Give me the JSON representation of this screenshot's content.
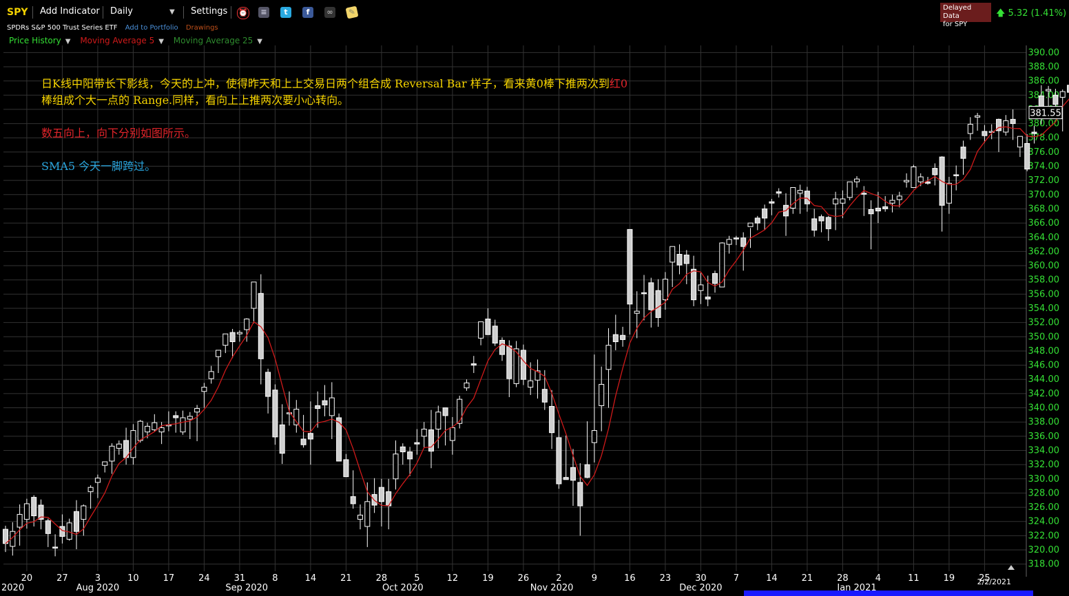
{
  "toolbar": {
    "ticker": "SPY",
    "add_indicator": "Add Indicator",
    "period": "Daily",
    "settings": "Settings",
    "delayed_line1": "Delayed Data",
    "delayed_line2": "for SPY",
    "change": "5.32 (1.41%)"
  },
  "subheader": {
    "name": "SPDRs S&P 500 Trust Series ETF",
    "add_portfolio": "Add to Portfolio",
    "drawings": "Drawings"
  },
  "indicators": {
    "price_history": "Price History",
    "ma5": "Moving Average 5",
    "ma25": "Moving Average 25"
  },
  "colors": {
    "background": "#000000",
    "grid": "#333333",
    "candle": "#ffffff",
    "ma5": "#d01a1a",
    "price_history": "#35e035",
    "ma25": "#2e8b2e",
    "yellow": "#f5d300",
    "red_text": "#e0242a",
    "blue_text": "#2aa7e0",
    "axis_text": "#35e035"
  },
  "annotations": {
    "line1_main": "日K线中阳带长下影线，今天的上冲，使得昨天和上上交易日两个组合成 Reversal Bar 样子，看来黄0棒下推两次到",
    "line1_red": "红0",
    "line2": "棒组成个大一点的 Range.同样，看向上上推两次要小心转向。",
    "line3": "数五向上，向下分别如图所示。",
    "line4": "SMA5 今天一脚跨过。"
  },
  "chart_data": {
    "type": "candlestick",
    "ylim": [
      318,
      390
    ],
    "y_ticks": [
      318,
      320,
      322,
      324,
      326,
      328,
      330,
      332,
      334,
      336,
      338,
      340,
      342,
      344,
      346,
      348,
      350,
      352,
      354,
      356,
      358,
      360,
      362,
      364,
      366,
      368,
      370,
      372,
      374,
      376,
      378,
      380,
      382,
      384,
      386,
      388,
      390
    ],
    "last_price": "381.55",
    "x_tick_labels": [
      "20",
      "27",
      "3",
      "10",
      "17",
      "24",
      "31",
      "8",
      "14",
      "21",
      "28",
      "5",
      "12",
      "19",
      "26",
      "2",
      "9",
      "16",
      "23",
      "30",
      "7",
      "14",
      "21",
      "28",
      "4",
      "11",
      "19",
      "25"
    ],
    "x_month_labels": [
      "2020",
      "Aug 2020",
      "Sep 2020",
      "Oct 2020",
      "Nov 2020",
      "Dec 2020",
      "Jan 2021"
    ],
    "last_date": "2/2/2021",
    "candles": [
      [
        322.9,
        323.4,
        319.7,
        320.9
      ],
      [
        320.5,
        323.9,
        319.2,
        322.6
      ],
      [
        323.2,
        326.4,
        320.6,
        325.0
      ],
      [
        324.3,
        327.2,
        323.0,
        326.5
      ],
      [
        327.4,
        327.7,
        323.3,
        324.8
      ],
      [
        326.3,
        327.1,
        322.9,
        324.3
      ],
      [
        324.1,
        324.4,
        320.4,
        322.3
      ],
      [
        320.4,
        322.2,
        319.1,
        320.3
      ],
      [
        323.3,
        325.0,
        320.9,
        321.9
      ],
      [
        321.5,
        324.4,
        321.3,
        323.8
      ],
      [
        325.4,
        327.0,
        320.1,
        322.6
      ],
      [
        324.3,
        326.4,
        322.0,
        326.2
      ],
      [
        328.2,
        329.1,
        325.8,
        328.8
      ],
      [
        329.5,
        330.6,
        327.3,
        330.1
      ],
      [
        331.9,
        332.4,
        330.9,
        332.4
      ],
      [
        332.5,
        335.0,
        330.7,
        334.6
      ],
      [
        334.3,
        335.4,
        333.4,
        334.9
      ],
      [
        335.4,
        337.2,
        332.0,
        333.0
      ],
      [
        333.0,
        337.7,
        332.0,
        336.8
      ],
      [
        335.4,
        338.3,
        335.1,
        338.1
      ],
      [
        336.6,
        337.9,
        335.7,
        337.4
      ],
      [
        336.9,
        339.1,
        336.7,
        337.9
      ],
      [
        336.6,
        338.0,
        334.9,
        337.2
      ],
      [
        337.5,
        339.5,
        336.7,
        337.6
      ],
      [
        338.9,
        339.5,
        336.5,
        338.6
      ],
      [
        336.6,
        339.6,
        336.2,
        338.6
      ],
      [
        338.4,
        339.4,
        335.6,
        338.8
      ],
      [
        339.4,
        340.4,
        335.3,
        339.9
      ],
      [
        342.3,
        343.5,
        340.0,
        342.9
      ],
      [
        344.1,
        345.9,
        343.4,
        345.1
      ],
      [
        347.2,
        347.9,
        344.9,
        348.1
      ],
      [
        348.8,
        350.3,
        347.7,
        350.4
      ],
      [
        350.6,
        351.1,
        347.0,
        349.3
      ],
      [
        350.4,
        350.9,
        349.3,
        350.6
      ],
      [
        351.0,
        352.6,
        349.3,
        352.5
      ],
      [
        354.0,
        357.7,
        351.9,
        357.7
      ],
      [
        356.1,
        358.8,
        343.3,
        346.9
      ],
      [
        345.0,
        345.5,
        339.2,
        341.6
      ],
      [
        342.5,
        343.3,
        334.8,
        335.9
      ],
      [
        337.6,
        340.5,
        332.1,
        333.6
      ],
      [
        339.2,
        342.3,
        337.5,
        339.3
      ],
      [
        337.6,
        341.1,
        336.5,
        339.8
      ],
      [
        335.6,
        339.0,
        334.4,
        334.8
      ],
      [
        336.4,
        340.9,
        332.0,
        335.6
      ],
      [
        340.3,
        342.3,
        337.2,
        339.9
      ],
      [
        341.0,
        343.2,
        338.8,
        340.4
      ],
      [
        338.9,
        343.6,
        335.6,
        341.4
      ],
      [
        338.6,
        339.2,
        332.5,
        332.5
      ],
      [
        332.7,
        333.5,
        330.6,
        330.3
      ],
      [
        327.5,
        331.2,
        325.8,
        326.5
      ],
      [
        324.3,
        326.4,
        322.9,
        324.9
      ],
      [
        323.3,
        329.5,
        320.4,
        326.8
      ],
      [
        327.8,
        330.1,
        325.2,
        326.3
      ],
      [
        328.8,
        330.0,
        323.3,
        326.8
      ],
      [
        328.2,
        330.0,
        322.9,
        326.2
      ],
      [
        330.0,
        335.4,
        328.5,
        333.5
      ],
      [
        334.5,
        335.0,
        332.0,
        333.8
      ],
      [
        333.8,
        334.5,
        330.4,
        332.8
      ],
      [
        335.1,
        337.0,
        333.4,
        334.9
      ],
      [
        336.0,
        338.0,
        334.4,
        337.0
      ],
      [
        336.9,
        339.7,
        331.5,
        333.9
      ],
      [
        337.0,
        340.3,
        334.3,
        339.4
      ],
      [
        340.0,
        340.0,
        334.7,
        338.9
      ],
      [
        335.4,
        338.7,
        333.4,
        337.2
      ],
      [
        337.8,
        341.7,
        337.1,
        341.2
      ],
      [
        342.8,
        344.0,
        342.4,
        343.5
      ],
      [
        346.2,
        347.3,
        344.9,
        346.0
      ],
      [
        349.8,
        352.0,
        348.8,
        352.1
      ],
      [
        352.5,
        354.0,
        350.6,
        350.3
      ],
      [
        351.5,
        352.4,
        348.7,
        349.1
      ],
      [
        349.5,
        349.9,
        346.6,
        347.5
      ],
      [
        348.7,
        349.5,
        341.5,
        344.1
      ],
      [
        343.4,
        349.4,
        342.9,
        348.3
      ],
      [
        348.1,
        348.9,
        343.2,
        344.0
      ],
      [
        342.9,
        346.4,
        341.8,
        343.8
      ],
      [
        343.9,
        346.8,
        341.3,
        345.2
      ],
      [
        342.6,
        345.3,
        339.7,
        340.8
      ],
      [
        340.2,
        342.5,
        334.2,
        336.5
      ],
      [
        335.8,
        338.3,
        328.6,
        329.3
      ],
      [
        330.2,
        336.1,
        330.0,
        329.9
      ],
      [
        331.6,
        334.2,
        326.2,
        329.8
      ],
      [
        329.5,
        332.2,
        322.0,
        326.2
      ],
      [
        332.0,
        338.1,
        330.1,
        330.2
      ],
      [
        335.1,
        347.5,
        332.3,
        336.8
      ],
      [
        340.3,
        345.8,
        336.7,
        343.3
      ],
      [
        345.4,
        351.2,
        340.0,
        348.8
      ],
      [
        350.3,
        353.1,
        348.1,
        349.3
      ],
      [
        350.2,
        351.4,
        348.6,
        349.6
      ],
      [
        365.1,
        364.4,
        350.3,
        354.6
      ],
      [
        353.3,
        356.4,
        349.8,
        353.6
      ],
      [
        356.2,
        358.7,
        352.3,
        356.1
      ],
      [
        357.6,
        358.3,
        351.3,
        353.8
      ],
      [
        356.5,
        358.1,
        351.4,
        352.7
      ],
      [
        355.2,
        359.1,
        353.8,
        358.1
      ],
      [
        360.5,
        362.2,
        357.0,
        362.7
      ],
      [
        361.6,
        363.0,
        358.8,
        360.1
      ],
      [
        361.5,
        362.2,
        357.4,
        360.3
      ],
      [
        359.5,
        361.4,
        354.3,
        355.2
      ],
      [
        356.5,
        359.0,
        354.6,
        357.3
      ],
      [
        355.6,
        358.6,
        354.3,
        355.3
      ],
      [
        358.9,
        359.3,
        356.2,
        357.5
      ],
      [
        357.0,
        363.3,
        357.7,
        363.2
      ],
      [
        363.0,
        364.2,
        361.7,
        363.7
      ],
      [
        363.9,
        364.2,
        362.9,
        363.8
      ],
      [
        363.9,
        364.7,
        359.3,
        362.7
      ],
      [
        365.5,
        365.3,
        362.5,
        366.0
      ],
      [
        366.7,
        367.0,
        365.0,
        366.0
      ],
      [
        368.0,
        368.6,
        365.0,
        366.7
      ],
      [
        369.0,
        369.4,
        367.1,
        368.8
      ],
      [
        370.4,
        370.9,
        369.6,
        370.2
      ],
      [
        368.5,
        370.2,
        364.2,
        367.0
      ],
      [
        368.1,
        371.0,
        367.3,
        371.0
      ],
      [
        370.2,
        371.4,
        367.3,
        370.6
      ],
      [
        370.5,
        371.1,
        367.6,
        368.7
      ],
      [
        366.6,
        368.0,
        364.1,
        365.0
      ],
      [
        366.9,
        367.2,
        364.7,
        366.3
      ],
      [
        366.8,
        367.0,
        363.5,
        365.2
      ],
      [
        368.7,
        370.4,
        365.0,
        369.4
      ],
      [
        368.8,
        370.6,
        366.7,
        369.4
      ],
      [
        369.6,
        371.7,
        369.2,
        371.8
      ],
      [
        371.8,
        372.6,
        371.0,
        372.2
      ],
      [
        370.2,
        371.2,
        367.0,
        370.1
      ],
      [
        367.9,
        369.2,
        362.3,
        367.3
      ],
      [
        368.1,
        370.4,
        366.0,
        367.7
      ],
      [
        368.3,
        369.8,
        367.6,
        368.0
      ],
      [
        368.8,
        370.0,
        367.5,
        369.2
      ],
      [
        369.3,
        370.4,
        368.2,
        369.8
      ],
      [
        371.8,
        373.0,
        371.0,
        372.0
      ],
      [
        371.0,
        374.2,
        371.2,
        373.9
      ],
      [
        371.8,
        373.0,
        371.2,
        372.5
      ],
      [
        371.8,
        372.5,
        371.4,
        371.6
      ],
      [
        373.7,
        374.4,
        371.3,
        372.8
      ],
      [
        375.3,
        375.4,
        364.8,
        368.5
      ],
      [
        368.8,
        372.5,
        367.3,
        371.6
      ],
      [
        372.8,
        374.1,
        370.6,
        372.7
      ],
      [
        376.7,
        377.6,
        372.8,
        375.1
      ],
      [
        378.6,
        380.9,
        377.7,
        379.9
      ],
      [
        380.9,
        381.5,
        379.0,
        381.1
      ],
      [
        378.9,
        379.8,
        377.3,
        378.3
      ],
      [
        378.8,
        379.9,
        377.8,
        378.9
      ],
      [
        380.6,
        380.7,
        376.0,
        379.0
      ],
      [
        378.8,
        381.2,
        378.3,
        380.4
      ],
      [
        380.6,
        382.0,
        377.7,
        380.0
      ],
      [
        376.7,
        377.4,
        375.3,
        378.2
      ],
      [
        377.2,
        378.5,
        373.3,
        373.6
      ],
      [
        378.8,
        379.7,
        377.2,
        378.6
      ],
      [
        383.9,
        385.4,
        379.9,
        381.4
      ],
      [
        384.6,
        385.3,
        381.5,
        384.8
      ],
      [
        384.0,
        384.9,
        381.7,
        382.7
      ],
      [
        383.7,
        384.8,
        378.9,
        384.5
      ],
      [
        385.4,
        385.9,
        376.7,
        384.4
      ],
      [
        380.2,
        380.7,
        372.2,
        374.4
      ],
      [
        377.6,
        377.9,
        368.9,
        374.0
      ],
      [
        370.7,
        376.7,
        368.3,
        370.1
      ],
      [
        376.2,
        377.3,
        371.9,
        376.2
      ],
      [
        378.5,
        383.2,
        376.6,
        381.6
      ]
    ]
  }
}
